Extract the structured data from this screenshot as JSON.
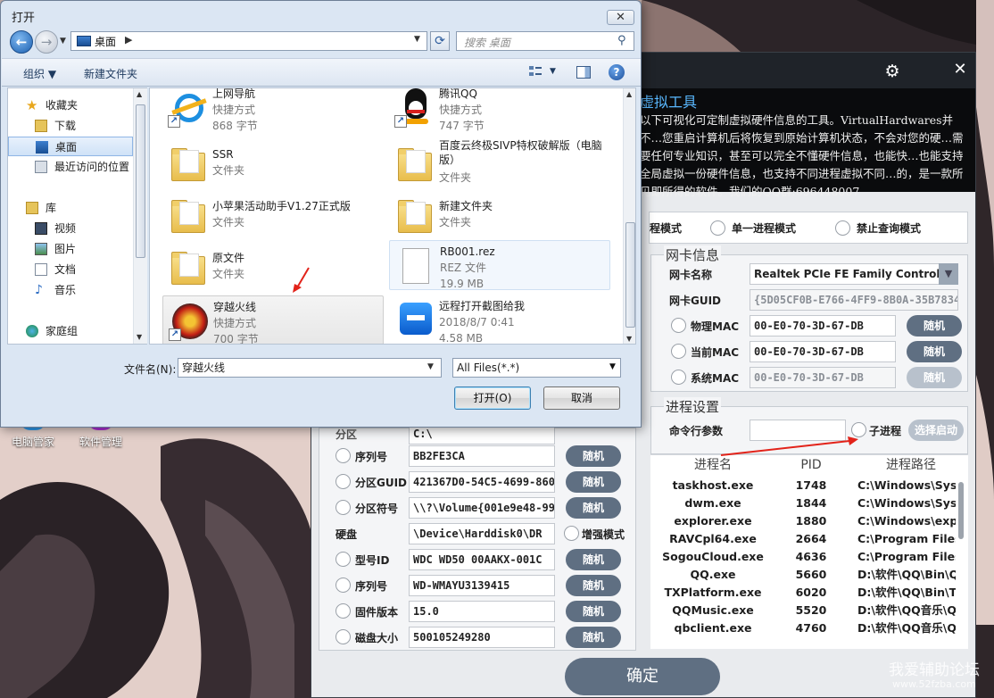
{
  "desktop": {
    "icons": [
      {
        "label": "电脑管家"
      },
      {
        "label": "软件管理"
      }
    ],
    "watermark": "我爱辅助论坛",
    "watermark_url": "www.52fzba.com"
  },
  "app": {
    "heading": "虚拟工具",
    "description": "以下可视化可定制虚拟硬件信息的工具。VirtualHardwares并不…您重启计算机后将恢复到原始计算机状态，不会对您的硬…需要任何专业知识，甚至可以完全不懂硬件信息，也能快…也能支持全局虚拟一份硬件信息，也支持不同进程虚拟不同…的，是一款所见即所得的软件。我们的QQ群:696448007",
    "modes": [
      "程模式",
      "单一进程模式",
      "禁止查询模式"
    ],
    "nic": {
      "title": "网卡信息",
      "name_label": "网卡名称",
      "name_value": "Realtek PCIe FE Family Controller",
      "guid_label": "网卡GUID",
      "guid_value": "{5D05CF0B-E766-4FF9-8B0A-35B7834",
      "physical_label": "物理MAC",
      "physical_value": "00-E0-70-3D-67-DB",
      "current_label": "当前MAC",
      "current_value": "00-E0-70-3D-67-DB",
      "system_label": "系统MAC",
      "system_value": "00-E0-70-3D-67-DB"
    },
    "random_label": "随机",
    "process": {
      "title": "进程设置",
      "cmd_label": "命令行参数",
      "cmd_value": "",
      "child_label": "子进程",
      "select_launch": "选择启动",
      "headers": [
        "进程名",
        "PID",
        "进程路径"
      ],
      "rows": [
        {
          "name": "taskhost.exe",
          "pid": "1748",
          "path": "C:\\Windows\\Syster"
        },
        {
          "name": "dwm.exe",
          "pid": "1844",
          "path": "C:\\Windows\\Syster"
        },
        {
          "name": "explorer.exe",
          "pid": "1880",
          "path": "C:\\Windows\\explo"
        },
        {
          "name": "RAVCpl64.exe",
          "pid": "2664",
          "path": "C:\\Program Files\\R"
        },
        {
          "name": "SogouCloud.exe",
          "pid": "4636",
          "path": "C:\\Program Files (x"
        },
        {
          "name": "QQ.exe",
          "pid": "5660",
          "path": "D:\\软件\\QQ\\Bin\\Q"
        },
        {
          "name": "TXPlatform.exe",
          "pid": "6020",
          "path": "D:\\软件\\QQ\\Bin\\TX"
        },
        {
          "name": "QQMusic.exe",
          "pid": "5520",
          "path": "D:\\软件\\QQ音乐\\QC"
        },
        {
          "name": "qbclient.exe",
          "pid": "4760",
          "path": "D:\\软件\\QQ音乐\\QC"
        }
      ]
    },
    "disk": {
      "partition_label": "分区",
      "partition_value": "C:\\",
      "serial_label": "序列号",
      "serial_value": "BB2FE3CA",
      "pguid_label": "分区GUID",
      "pguid_value": "421367D0-54C5-4699-8601",
      "psymbol_label": "分区符号",
      "psymbol_value": "\\\\?\\Volume{001e9e48-999",
      "hdd_label": "硬盘",
      "hdd_value": "\\Device\\Harddisk0\\DR",
      "enhanced_label": "增强模式",
      "model_label": "型号ID",
      "model_value": "WDC WD50 00AAKX-001C",
      "hserial_label": "序列号",
      "hserial_value": "WD-WMAYU3139415",
      "firmware_label": "固件版本",
      "firmware_value": "15.0",
      "size_label": "磁盘大小",
      "size_value": "500105249280"
    },
    "confirm": "确定"
  },
  "dialog": {
    "title": "打开",
    "close_glyph": "✕",
    "address": "桌面",
    "address_sep": "▶",
    "search_placeholder": "搜索 桌面",
    "organize": "组织 ▼",
    "new_folder": "新建文件夹",
    "nav": [
      {
        "label": "收藏夹"
      },
      {
        "label": "下载"
      },
      {
        "label": "桌面"
      },
      {
        "label": "最近访问的位置"
      },
      {
        "label": "库"
      },
      {
        "label": "视频"
      },
      {
        "label": "图片"
      },
      {
        "label": "文档"
      },
      {
        "label": "音乐"
      },
      {
        "label": "家庭组"
      }
    ],
    "files": [
      {
        "name": "上网导航",
        "type": "快捷方式",
        "size": "868 字节"
      },
      {
        "name": "腾讯QQ",
        "type": "快捷方式",
        "size": "747 字节"
      },
      {
        "name": "SSR",
        "type": "文件夹",
        "size": ""
      },
      {
        "name": "百度云终极SIVP特权破解版（电脑版）",
        "type": "文件夹",
        "size": ""
      },
      {
        "name": "小苹果活动助手V1.27正式版",
        "type": "文件夹",
        "size": ""
      },
      {
        "name": "新建文件夹",
        "type": "文件夹",
        "size": ""
      },
      {
        "name": "原文件",
        "type": "文件夹",
        "size": ""
      },
      {
        "name": "RB001.rez",
        "type": "REZ 文件",
        "size": "19.9 MB"
      },
      {
        "name": "穿越火线",
        "type": "快捷方式",
        "size": "700 字节"
      },
      {
        "name": "远程打开截图给我",
        "type": "2018/8/7 0:41",
        "size": "4.58 MB"
      }
    ],
    "filename_label": "文件名(N):",
    "filename_value": "穿越火线",
    "filetype_value": "All Files(*.*)",
    "open_button": "打开(O)",
    "cancel_button": "取消"
  }
}
